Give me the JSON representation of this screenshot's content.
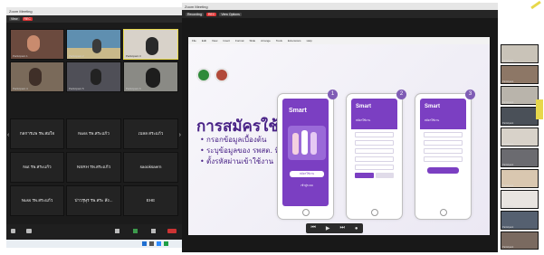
{
  "left_window": {
    "title": "Zoom Meeting",
    "top_pills": [
      "View",
      "REC"
    ],
    "participants": [
      {
        "label": "Participant 1",
        "kind": "video",
        "bg": "#6b4a3e"
      },
      {
        "label": "Participant 2",
        "kind": "video",
        "bg": "#5f8fb0"
      },
      {
        "label": "Participant 3",
        "kind": "video",
        "bg": "#d8d2c9",
        "highlighted": true
      },
      {
        "label": "Participant 4",
        "kind": "video",
        "bg": "#7a6a5a"
      },
      {
        "label": "Participant 5",
        "kind": "video",
        "bg": "#4f4f57"
      },
      {
        "label": "Participant 6",
        "kind": "video",
        "bg": "#8a8a85"
      },
      {
        "label": "กลการแพ รพ.สมใจ",
        "kind": "name"
      },
      {
        "label": "Nuss รพ.สระแก้ว",
        "kind": "name"
      },
      {
        "label": "เบลล สระแก้ว",
        "kind": "name"
      },
      {
        "label": "Nut รพ.สระแก้ว",
        "kind": "name"
      },
      {
        "label": "NSRH รพ.สระแก้ว",
        "kind": "name"
      },
      {
        "label": "saooksaern",
        "kind": "name"
      },
      {
        "label": "Nuss รพ.สระแก้ว",
        "kind": "name"
      },
      {
        "label": "ปาวรุษุร รพ.สระ สัง...",
        "kind": "name"
      },
      {
        "label": "EHE",
        "kind": "name"
      }
    ]
  },
  "main_window": {
    "title": "Zoom Meeting",
    "top_pills": [
      "Recording",
      "REC",
      "View Options"
    ],
    "toolbar_items": [
      "File",
      "Edit",
      "View",
      "Insert",
      "Format",
      "Slide",
      "Arrange",
      "Tools",
      "Extensions",
      "Help"
    ],
    "slide": {
      "headline": "การสมัครใช้งาน",
      "bullets": [
        "กรอกข้อมูลเบื้องต้น",
        "ระบุข้อมูลของ รพสต. ที่ สนเองยังได้",
        "ตั้งรหัสผ่านเข้าใช้งาน"
      ],
      "phone_badges": [
        "1",
        "2",
        "3"
      ],
      "app_name": "Smart",
      "phone1_button": "สมัครใช้งาน",
      "phone1_link": "เข้าสู่ระบบ",
      "phone2_header": "สมัครใช้งาน",
      "phone3_header": "สมัครใช้งาน"
    },
    "media_controls": [
      "⏮",
      "▶",
      "⏭",
      "●"
    ]
  },
  "right_strip": [
    {
      "label": "Participant",
      "bg": "#c9c3b8"
    },
    {
      "label": "Participant",
      "bg": "#8d7766"
    },
    {
      "label": "Participant",
      "bg": "#b9b4ab"
    },
    {
      "label": "Participant",
      "bg": "#4a5058"
    },
    {
      "label": "Participant",
      "bg": "#d8d2c9"
    },
    {
      "label": "Participant",
      "bg": "#6b6b70"
    },
    {
      "label": "Participant",
      "bg": "#d9c7b0"
    },
    {
      "label": "Participant",
      "bg": "#e8e4e0"
    },
    {
      "label": "Participant",
      "bg": "#556070"
    },
    {
      "label": "Participant",
      "bg": "#7a6a60"
    },
    {
      "label": "Participant",
      "bg": "#c0b8c8"
    }
  ],
  "colors": {
    "slide_purple": "#4a2387",
    "app_purple": "#7b3fc2",
    "accent_yellow": "#e7d84b"
  }
}
